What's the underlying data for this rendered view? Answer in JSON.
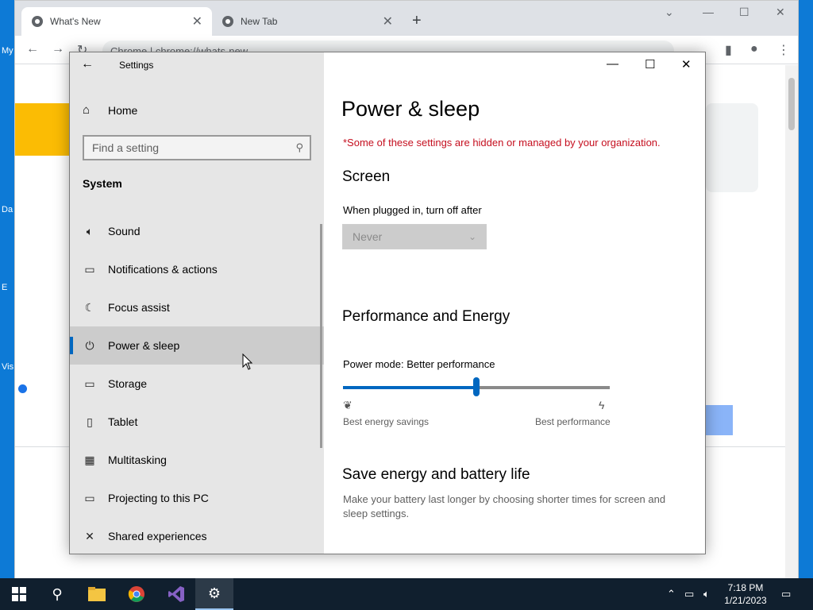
{
  "desktop": {
    "labels": [
      "My",
      "Da",
      "E",
      "Vis"
    ]
  },
  "chrome": {
    "tabs": [
      {
        "title": "What's New",
        "active": true
      },
      {
        "title": "New Tab",
        "active": false
      }
    ],
    "omnibox_text": "Chrome  |  chrome://whats-new"
  },
  "settings": {
    "app_title": "Settings",
    "home_label": "Home",
    "search_placeholder": "Find a setting",
    "section_label": "System",
    "nav_items": [
      {
        "label": "Sound",
        "icon": "speaker-icon"
      },
      {
        "label": "Notifications & actions",
        "icon": "notification-icon"
      },
      {
        "label": "Focus assist",
        "icon": "moon-icon"
      },
      {
        "label": "Power & sleep",
        "icon": "power-icon",
        "selected": true
      },
      {
        "label": "Storage",
        "icon": "storage-icon"
      },
      {
        "label": "Tablet",
        "icon": "tablet-icon"
      },
      {
        "label": "Multitasking",
        "icon": "multitasking-icon"
      },
      {
        "label": "Projecting to this PC",
        "icon": "projector-icon"
      },
      {
        "label": "Shared experiences",
        "icon": "share-icon"
      }
    ],
    "page_title": "Power & sleep",
    "managed_notice": "*Some of these settings are hidden or managed by your organization.",
    "screen_heading": "Screen",
    "plugged_label": "When plugged in, turn off after",
    "plugged_value": "Never",
    "perf_heading": "Performance and Energy",
    "power_mode_label": "Power mode: Better performance",
    "power_mode_level": 0.5,
    "slider_left_label": "Best energy savings",
    "slider_right_label": "Best performance",
    "battery_heading": "Save energy and battery life",
    "battery_desc": "Make your battery last longer by choosing shorter times for screen and sleep settings."
  },
  "taskbar": {
    "time": "7:18 PM",
    "date": "1/21/2023"
  },
  "colors": {
    "accent": "#0067c0",
    "warning": "#c50f1f"
  }
}
